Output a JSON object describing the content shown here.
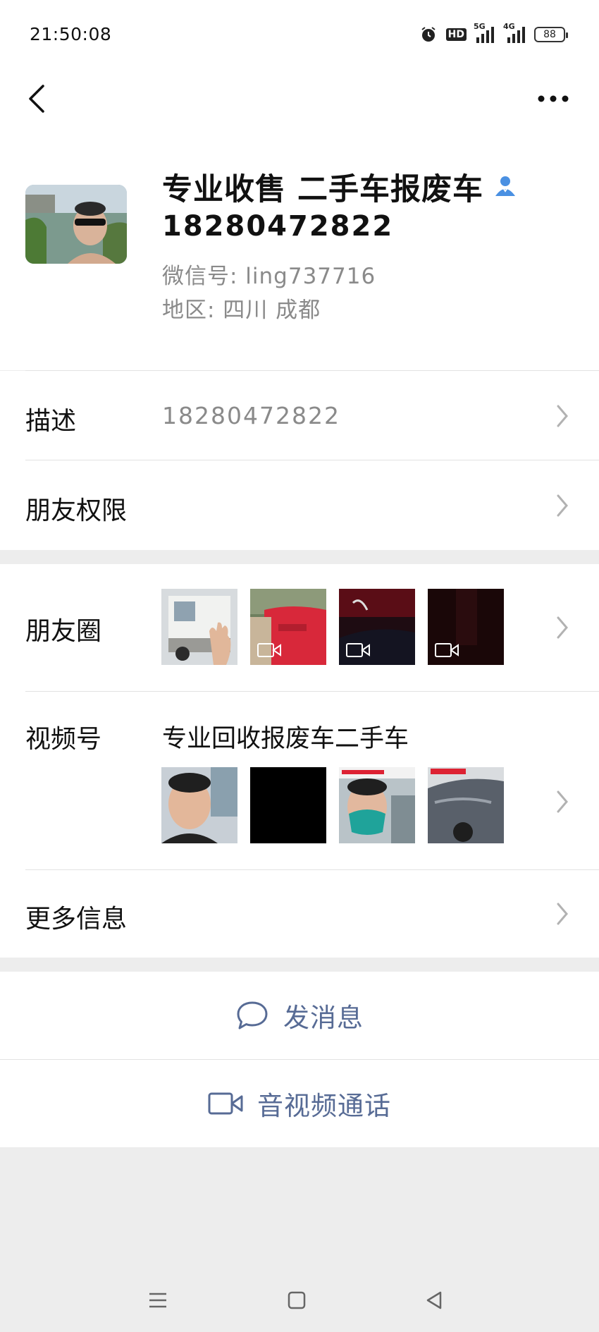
{
  "status": {
    "time": "21:50:08",
    "icons": [
      "alarm-icon",
      "hd-icon",
      "5g-signal-icon",
      "4g-signal-icon",
      "battery-icon"
    ],
    "hd_label": "HD",
    "net1": "5G",
    "net2": "4G",
    "battery": "88"
  },
  "nav": {
    "back_icon": "chevron-left-icon",
    "more_icon": "more-dots-icon"
  },
  "profile": {
    "name": "专业收售 二手车报废车",
    "phone": "18280472822",
    "wechat_id": "微信号:  ling737716",
    "region": "地区:  四川  成都",
    "badge_icon": "contact-person-icon",
    "badge_color": "#4a90e2"
  },
  "rows": {
    "description": {
      "label": "描述",
      "value": "18280472822"
    },
    "friend_permissions": {
      "label": "朋友权限"
    },
    "moments": {
      "label": "朋友圈"
    },
    "channels": {
      "label": "视频号",
      "title": "专业回收报废车二手车"
    },
    "more_info": {
      "label": "更多信息"
    }
  },
  "actions": {
    "message": {
      "label": "发消息",
      "icon": "chat-bubble-icon"
    },
    "call": {
      "label": "音视频通话",
      "icon": "video-camera-icon"
    }
  },
  "colors": {
    "link": "#576b95",
    "background": "#ededed",
    "secondary_text": "#8a8a8a"
  },
  "system_nav": [
    "menu-icon",
    "home-square-icon",
    "back-triangle-icon"
  ]
}
